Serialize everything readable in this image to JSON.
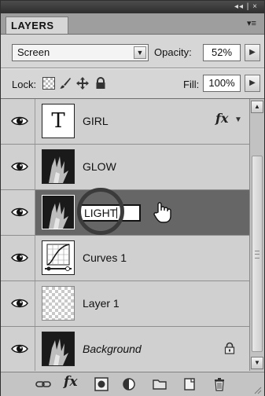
{
  "panel": {
    "tab_label": "LAYERS",
    "collapse_control": "◂◂ | ×"
  },
  "blending": {
    "mode": "Screen",
    "opacity_label": "Opacity:",
    "opacity_value": "52%",
    "lock_label": "Lock:",
    "fill_label": "Fill:",
    "fill_value": "100%"
  },
  "layers": [
    {
      "name": "GIRL",
      "thumbnail": "type-layer",
      "has_fx": true,
      "fx_label": "fx"
    },
    {
      "name": "GLOW",
      "thumbnail": "photo"
    },
    {
      "name": "LIGHT",
      "thumbnail": "photo",
      "selected": true,
      "editing_name": true
    },
    {
      "name": "Curves 1",
      "thumbnail": "curves-adjustment"
    },
    {
      "name": "Layer 1",
      "thumbnail": "transparent"
    },
    {
      "name": "Background",
      "thumbnail": "photo",
      "italic": true,
      "locked": true
    }
  ],
  "footer": {
    "fx_label": "fx",
    "icons": [
      "link-icon",
      "fx-icon",
      "mask-icon",
      "adjustment-icon",
      "folder-icon",
      "new-layer-icon",
      "trash-icon"
    ]
  },
  "colors": {
    "selected_row": "#666666",
    "panel_bg": "#d6d6d6",
    "highlight_circle": "#3b3b3b"
  }
}
